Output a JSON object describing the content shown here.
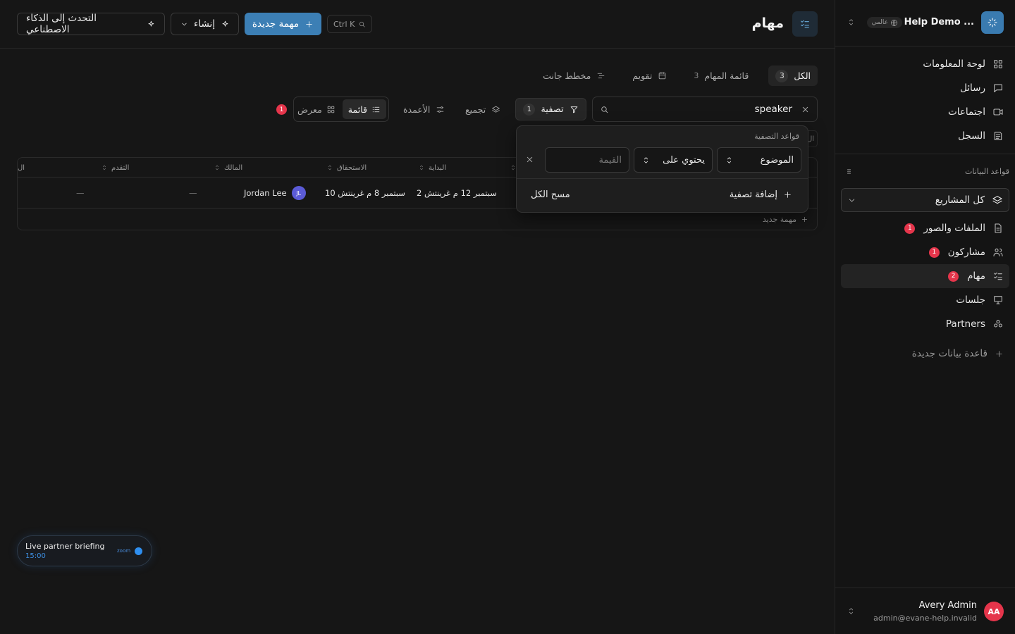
{
  "workspace": {
    "name": "Help Demo ...",
    "badge": "عالمي"
  },
  "nav": [
    {
      "label": "لوحة المعلومات",
      "icon": "dashboard-icon"
    },
    {
      "label": "رسائل",
      "icon": "message-icon"
    },
    {
      "label": "اجتماعات",
      "icon": "video-icon"
    },
    {
      "label": "السجل",
      "icon": "log-icon"
    }
  ],
  "databases": {
    "heading": "قواعد البيانات",
    "all_label": "كل المشاريع",
    "items": [
      {
        "label": "الملفات والصور",
        "badge": "1"
      },
      {
        "label": "مشاركون",
        "badge": "1"
      },
      {
        "label": "مهام",
        "badge": "2"
      },
      {
        "label": "جلسات",
        "badge": ""
      },
      {
        "label": "Partners",
        "badge": ""
      }
    ],
    "new_label": "قاعدة بيانات جديدة"
  },
  "user": {
    "name": "Avery Admin",
    "email": "admin@evane-help.invalid",
    "initials": "AA"
  },
  "header": {
    "title": "مهام",
    "shortcut": "Ctrl K",
    "new_task": "مهمة جديدة",
    "create": "إنشاء",
    "ai": "التحدث إلى الذكاء الاصطناعي"
  },
  "views": [
    {
      "label": "الكل",
      "count": "3"
    },
    {
      "label": "قائمة المهام",
      "count": "3"
    },
    {
      "label": "تقويم",
      "count": ""
    },
    {
      "label": "مخطط جانت",
      "count": ""
    }
  ],
  "toolbar": {
    "search_value": "speaker",
    "filter_label": "تصفية",
    "filter_count": "1",
    "group_label": "تجميع",
    "columns_label": "الأعمدة",
    "list_label": "قائمة",
    "gallery_label": "معرض",
    "alert_count": "1"
  },
  "filter_popover": {
    "title": "قواعد التصفية",
    "field": "الموضوع",
    "operator": "يحتوي على",
    "value_placeholder": "القيمة",
    "add_label": "إضافة تصفية",
    "clear_label": "مسح الكل"
  },
  "table": {
    "peek_label": "ال",
    "columns": [
      "البداية",
      "الاستحقاق",
      "المالك",
      "التقدم",
      "ال"
    ],
    "rows": [
      {
        "start": "2 سبتمبر 12 م غرينتش",
        "due": "10 سبتمبر 8 م غرينتش",
        "owner": "Jordan Lee",
        "owner_initials": "JL",
        "progress": "—",
        "extra": "—"
      }
    ],
    "new_row_label": "مهمة جديد"
  },
  "meeting": {
    "title": "Live partner briefing",
    "time": "15:00",
    "provider": "zoom"
  },
  "colors": {
    "accent": "#3c7fb5",
    "badge": "#e5354b",
    "background": "#161616"
  }
}
